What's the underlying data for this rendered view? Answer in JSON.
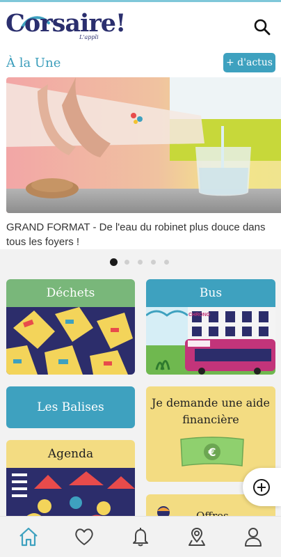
{
  "app": {
    "logo_text": "Corsaire!",
    "logo_subtext": "L'appli"
  },
  "header": {
    "search_icon": "search-icon"
  },
  "une": {
    "title": "À la Une",
    "more_button": "+ d'actus"
  },
  "feature": {
    "caption": "GRAND FORMAT - De l'eau du robinet plus douce dans tous les foyers !"
  },
  "carousel": {
    "dot_count": 5,
    "active_index": 0
  },
  "cards": {
    "dechets": {
      "title": "Déchets"
    },
    "bus": {
      "title": "Bus",
      "bus_label": "CHRONO"
    },
    "balises": {
      "title": "Les Balises"
    },
    "aide": {
      "title": "Je demande une aide financière",
      "currency_icon": "euro-icon"
    },
    "agenda": {
      "title": "Agenda"
    },
    "offres": {
      "title": "Offres d'emploi"
    }
  },
  "fab": {
    "icon": "add-circle-icon"
  },
  "tabbar": {
    "items": [
      {
        "name": "home",
        "icon": "home-icon"
      },
      {
        "name": "favorites",
        "icon": "heart-icon"
      },
      {
        "name": "notifications",
        "icon": "bell-icon"
      },
      {
        "name": "map",
        "icon": "map-pin-icon"
      },
      {
        "name": "profile",
        "icon": "user-icon"
      }
    ]
  },
  "colors": {
    "brand_navy": "#2b2f6e",
    "accent_teal": "#3ea1bf",
    "green": "#79b77a",
    "yellow": "#f3dc82"
  }
}
